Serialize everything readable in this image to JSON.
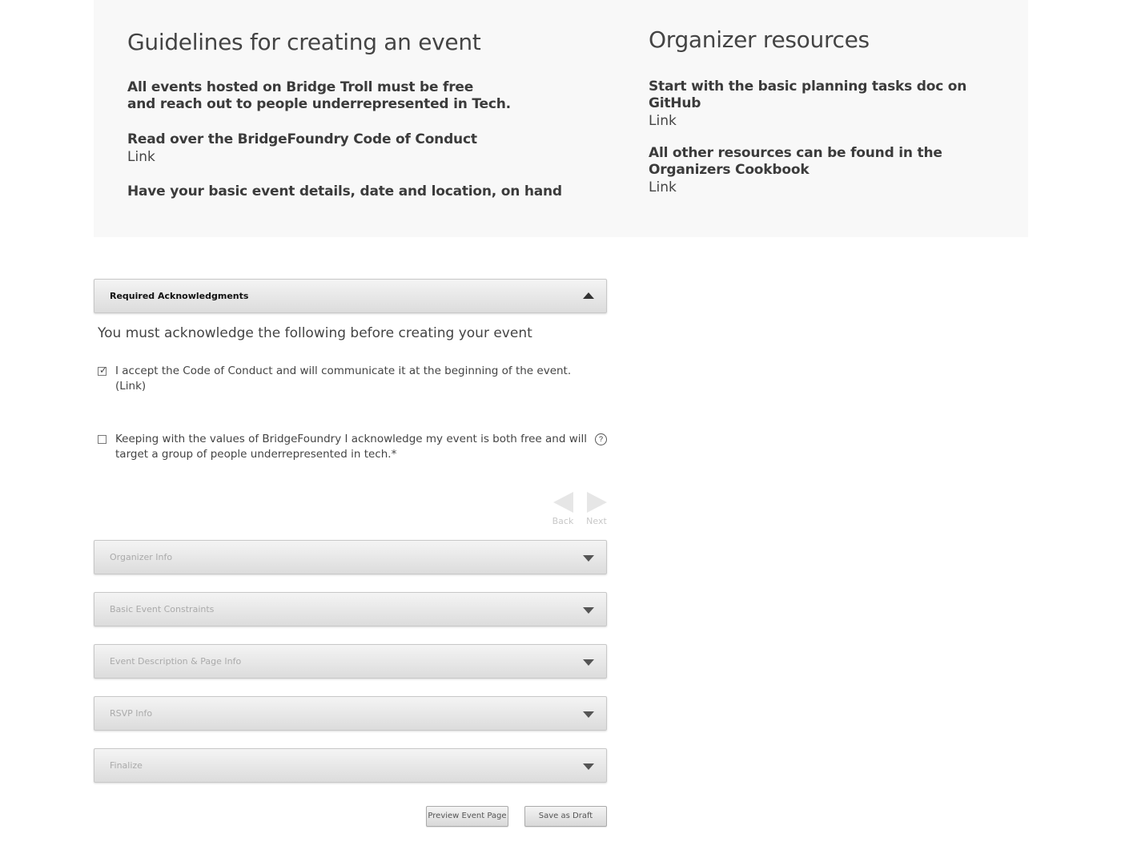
{
  "guidelines": {
    "title": "Guidelines for creating an event",
    "item1_line1": "All events hosted on Bridge Troll must be free",
    "item1_line2": "and reach out to people underrepresented in Tech.",
    "item2": "Read over the BridgeFoundry Code of Conduct",
    "item2_link": "Link",
    "item3": "Have your basic event details, date and location, on hand"
  },
  "resources": {
    "title": "Organizer resources",
    "item1": "Start with the basic planning tasks doc on GitHub",
    "item1_link": "Link",
    "item2_line1": "All other resources can be found in the",
    "item2_line2": "Organizers Cookbook",
    "item2_link": "Link"
  },
  "sections": {
    "required": "Required Acknowledgments",
    "organizer": "Organizer Info",
    "constraints": "Basic Event Constraints",
    "description": "Event Description & Page Info",
    "rsvp": "RSVP Info",
    "finalize": "Finalize"
  },
  "acknowledgments": {
    "heading": "You must acknowledge the following before creating your event",
    "coc_line1": "I accept the Code of Conduct and will communicate it at the beginning of the event.",
    "coc_line2": "(Link)",
    "coc_checked": true,
    "values_line1": "Keeping with the values of BridgeFoundry I acknowledge my event is both free and will",
    "values_line2": "target a group of people underrepresented in tech.*",
    "values_checked": false,
    "help_glyph": "?"
  },
  "nav": {
    "back": "Back",
    "next": "Next"
  },
  "actions": {
    "preview": "Preview Event Page",
    "save_draft": "Save as Draft"
  },
  "icons": {
    "checkmark": "check-icon",
    "help": "help-icon",
    "collapse": "chevron-up-icon",
    "expand": "chevron-down-icon"
  }
}
